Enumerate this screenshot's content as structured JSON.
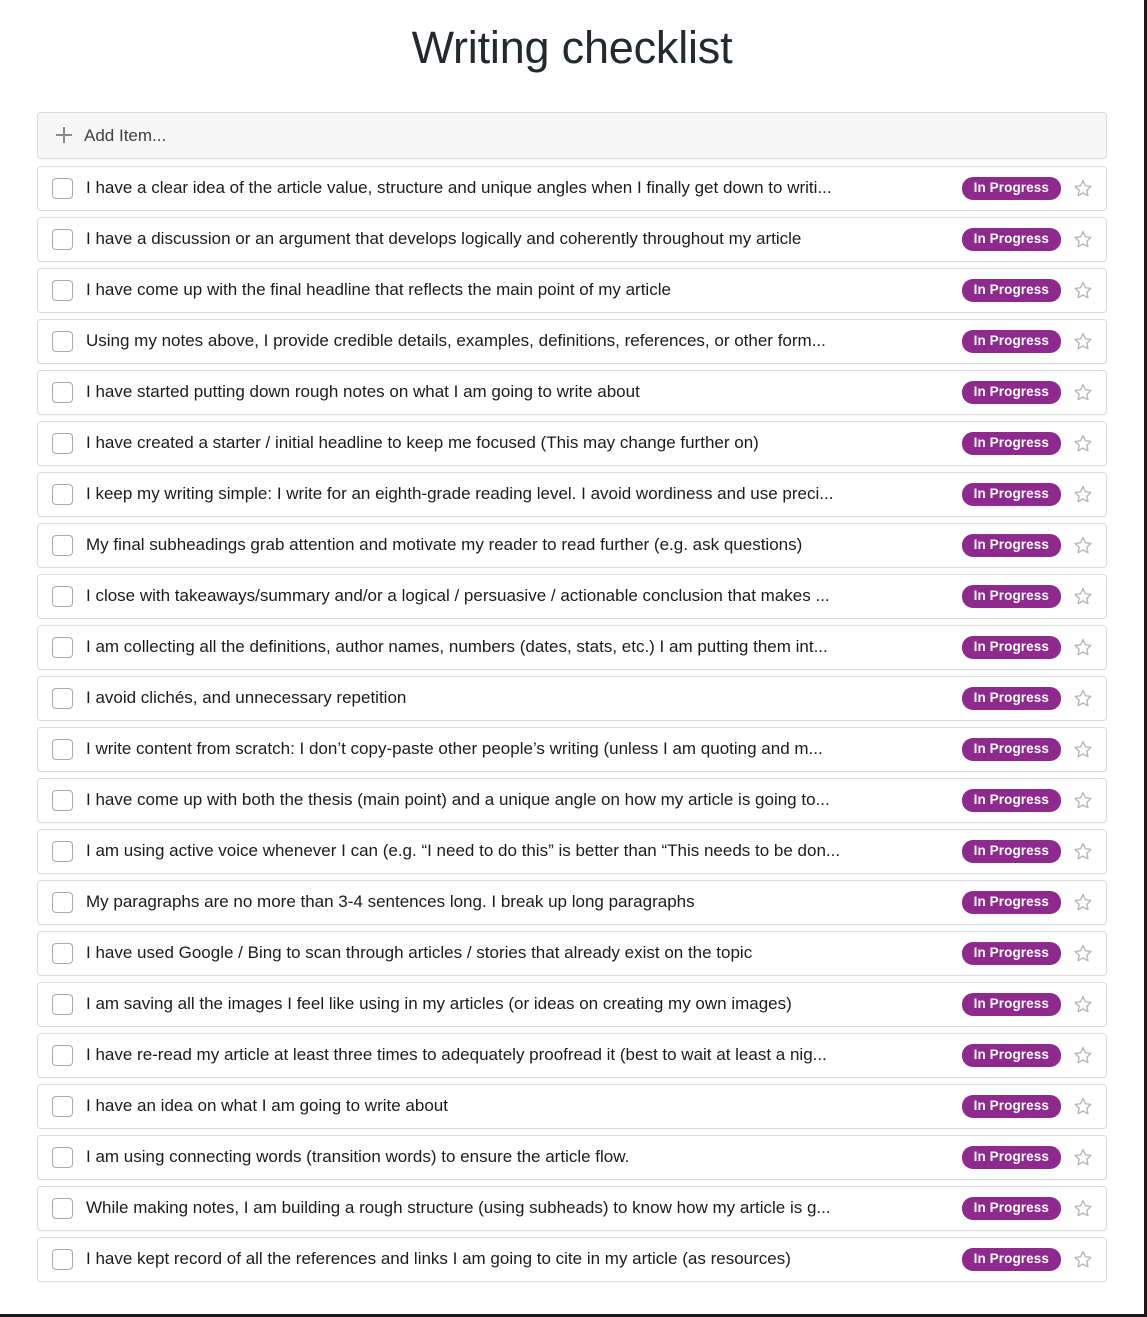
{
  "page": {
    "title": "Writing checklist",
    "background_color": "#ffffff"
  },
  "add_item": {
    "label": "Add Item...",
    "icon": "plus-icon"
  },
  "theme": {
    "badge_color": "#8e2a8e",
    "badge_text_color": "#ffffff",
    "border_color": "#dcdcdc",
    "text_color": "#1c1c1e",
    "star_color": "#b5b5b5"
  },
  "icons": {
    "checkbox": "checkbox-icon",
    "star": "star-outline-icon",
    "plus": "plus-icon"
  },
  "checklist": {
    "item_count": 22,
    "default_status": "In Progress",
    "items": [
      {
        "text": "I have a clear idea of the article value, structure and unique angles when I finally get down to writi...",
        "status": "In Progress",
        "checked": false,
        "starred": false
      },
      {
        "text": "I have a discussion or an argument that develops logically and coherently throughout my article",
        "status": "In Progress",
        "checked": false,
        "starred": false
      },
      {
        "text": "I have come up with the final headline that reflects the main point of my article",
        "status": "In Progress",
        "checked": false,
        "starred": false
      },
      {
        "text": "Using my notes above, I provide credible details, examples, definitions, references, or other form...",
        "status": "In Progress",
        "checked": false,
        "starred": false
      },
      {
        "text": "I have started putting down rough notes on what I am going to write about",
        "status": "In Progress",
        "checked": false,
        "starred": false
      },
      {
        "text": "I have created a starter / initial headline to keep me focused (This may change further on)",
        "status": "In Progress",
        "checked": false,
        "starred": false
      },
      {
        "text": "I keep my writing simple: I write for an eighth-grade reading level. I avoid wordiness and use preci...",
        "status": "In Progress",
        "checked": false,
        "starred": false
      },
      {
        "text": "My final subheadings grab attention and motivate my reader to read further (e.g. ask questions)",
        "status": "In Progress",
        "checked": false,
        "starred": false
      },
      {
        "text": "I close with takeaways/summary and/or a logical / persuasive / actionable conclusion that makes ...",
        "status": "In Progress",
        "checked": false,
        "starred": false
      },
      {
        "text": "I am collecting all the definitions, author names, numbers (dates, stats, etc.) I am putting them int...",
        "status": "In Progress",
        "checked": false,
        "starred": false
      },
      {
        "text": "I avoid clichés, and unnecessary repetition",
        "status": "In Progress",
        "checked": false,
        "starred": false
      },
      {
        "text": "I write content from scratch: I don’t copy-paste other people’s writing (unless I am quoting and m...",
        "status": "In Progress",
        "checked": false,
        "starred": false
      },
      {
        "text": "I have come up with both the thesis (main point) and a unique angle on how my article is going to...",
        "status": "In Progress",
        "checked": false,
        "starred": false
      },
      {
        "text": "I am using active voice whenever I can (e.g. “I need to do this” is better than “This needs to be don...",
        "status": "In Progress",
        "checked": false,
        "starred": false
      },
      {
        "text": "My paragraphs are no more than 3-4 sentences long. I break up long paragraphs",
        "status": "In Progress",
        "checked": false,
        "starred": false
      },
      {
        "text": "I have used Google / Bing to scan through articles / stories that already exist on the topic",
        "status": "In Progress",
        "checked": false,
        "starred": false
      },
      {
        "text": "I am saving all the images I feel like using in my articles (or ideas on creating my own images)",
        "status": "In Progress",
        "checked": false,
        "starred": false
      },
      {
        "text": "I have re-read my article at least three times to adequately proofread it (best to wait at least a nig...",
        "status": "In Progress",
        "checked": false,
        "starred": false
      },
      {
        "text": "I have an idea on what I am going to write about",
        "status": "In Progress",
        "checked": false,
        "starred": false
      },
      {
        "text": "I am using connecting words (transition words) to ensure the article flow.",
        "status": "In Progress",
        "checked": false,
        "starred": false
      },
      {
        "text": "While making notes, I am building a rough structure (using subheads) to know how my article is g...",
        "status": "In Progress",
        "checked": false,
        "starred": false
      },
      {
        "text": "I have kept record of all the references and links I am going to cite in my article (as resources)",
        "status": "In Progress",
        "checked": false,
        "starred": false
      }
    ]
  }
}
